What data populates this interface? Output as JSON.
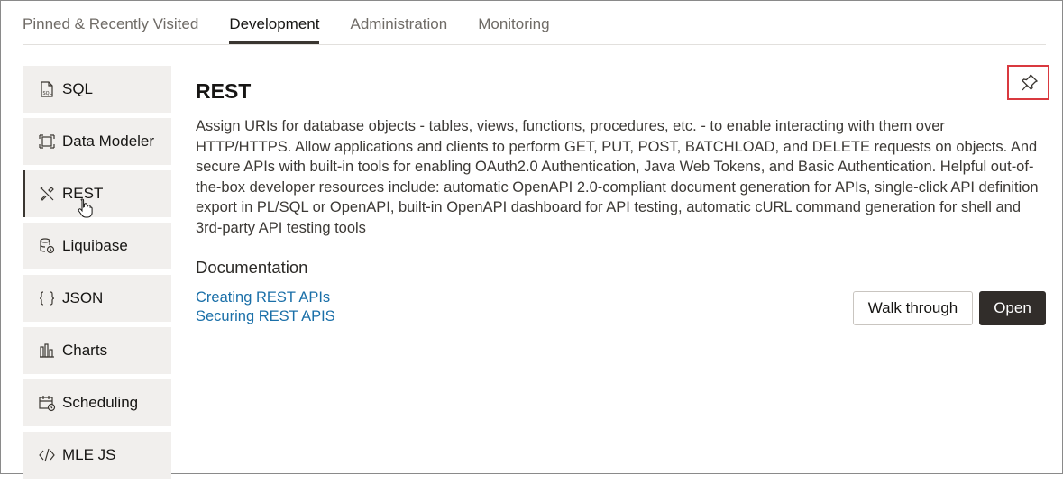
{
  "tabs": [
    {
      "label": "Pinned & Recently Visited"
    },
    {
      "label": "Development"
    },
    {
      "label": "Administration"
    },
    {
      "label": "Monitoring"
    }
  ],
  "active_tab": "Development",
  "sidebar": {
    "items": [
      {
        "label": "SQL",
        "icon": "sql-file-icon"
      },
      {
        "label": "Data Modeler",
        "icon": "data-modeler-icon"
      },
      {
        "label": "REST",
        "icon": "tools-icon"
      },
      {
        "label": "Liquibase",
        "icon": "database-icon"
      },
      {
        "label": "JSON",
        "icon": "braces-icon"
      },
      {
        "label": "Charts",
        "icon": "bar-chart-icon"
      },
      {
        "label": "Scheduling",
        "icon": "calendar-clock-icon"
      },
      {
        "label": "MLE JS",
        "icon": "code-icon"
      }
    ],
    "active": "REST"
  },
  "main": {
    "title": "REST",
    "description": "Assign URIs for database objects - tables, views, functions, procedures, etc. - to enable interacting with them over HTTP/HTTPS. Allow applications and clients to perform GET, PUT, POST, BATCHLOAD, and DELETE requests on objects. And secure APIs with built-in tools for enabling OAuth2.0 Authentication, Java Web Tokens, and Basic Authentication. Helpful out-of-the-box developer resources include: automatic OpenAPI 2.0-compliant document generation for APIs, single-click API definition export in PL/SQL or OpenAPI, built-in OpenAPI dashboard for API testing, automatic cURL command generation for shell and 3rd-party API testing tools",
    "documentation_heading": "Documentation",
    "links": [
      {
        "label": "Creating REST APIs"
      },
      {
        "label": "Securing REST APIS"
      }
    ],
    "walk_through_label": "Walk through",
    "open_label": "Open",
    "pin_icon": "pin-icon"
  },
  "colors": {
    "accent_dark": "#312d2a",
    "link": "#1a6fa8",
    "highlight_box": "#d9393f",
    "sidebar_bg": "#f1efed"
  }
}
